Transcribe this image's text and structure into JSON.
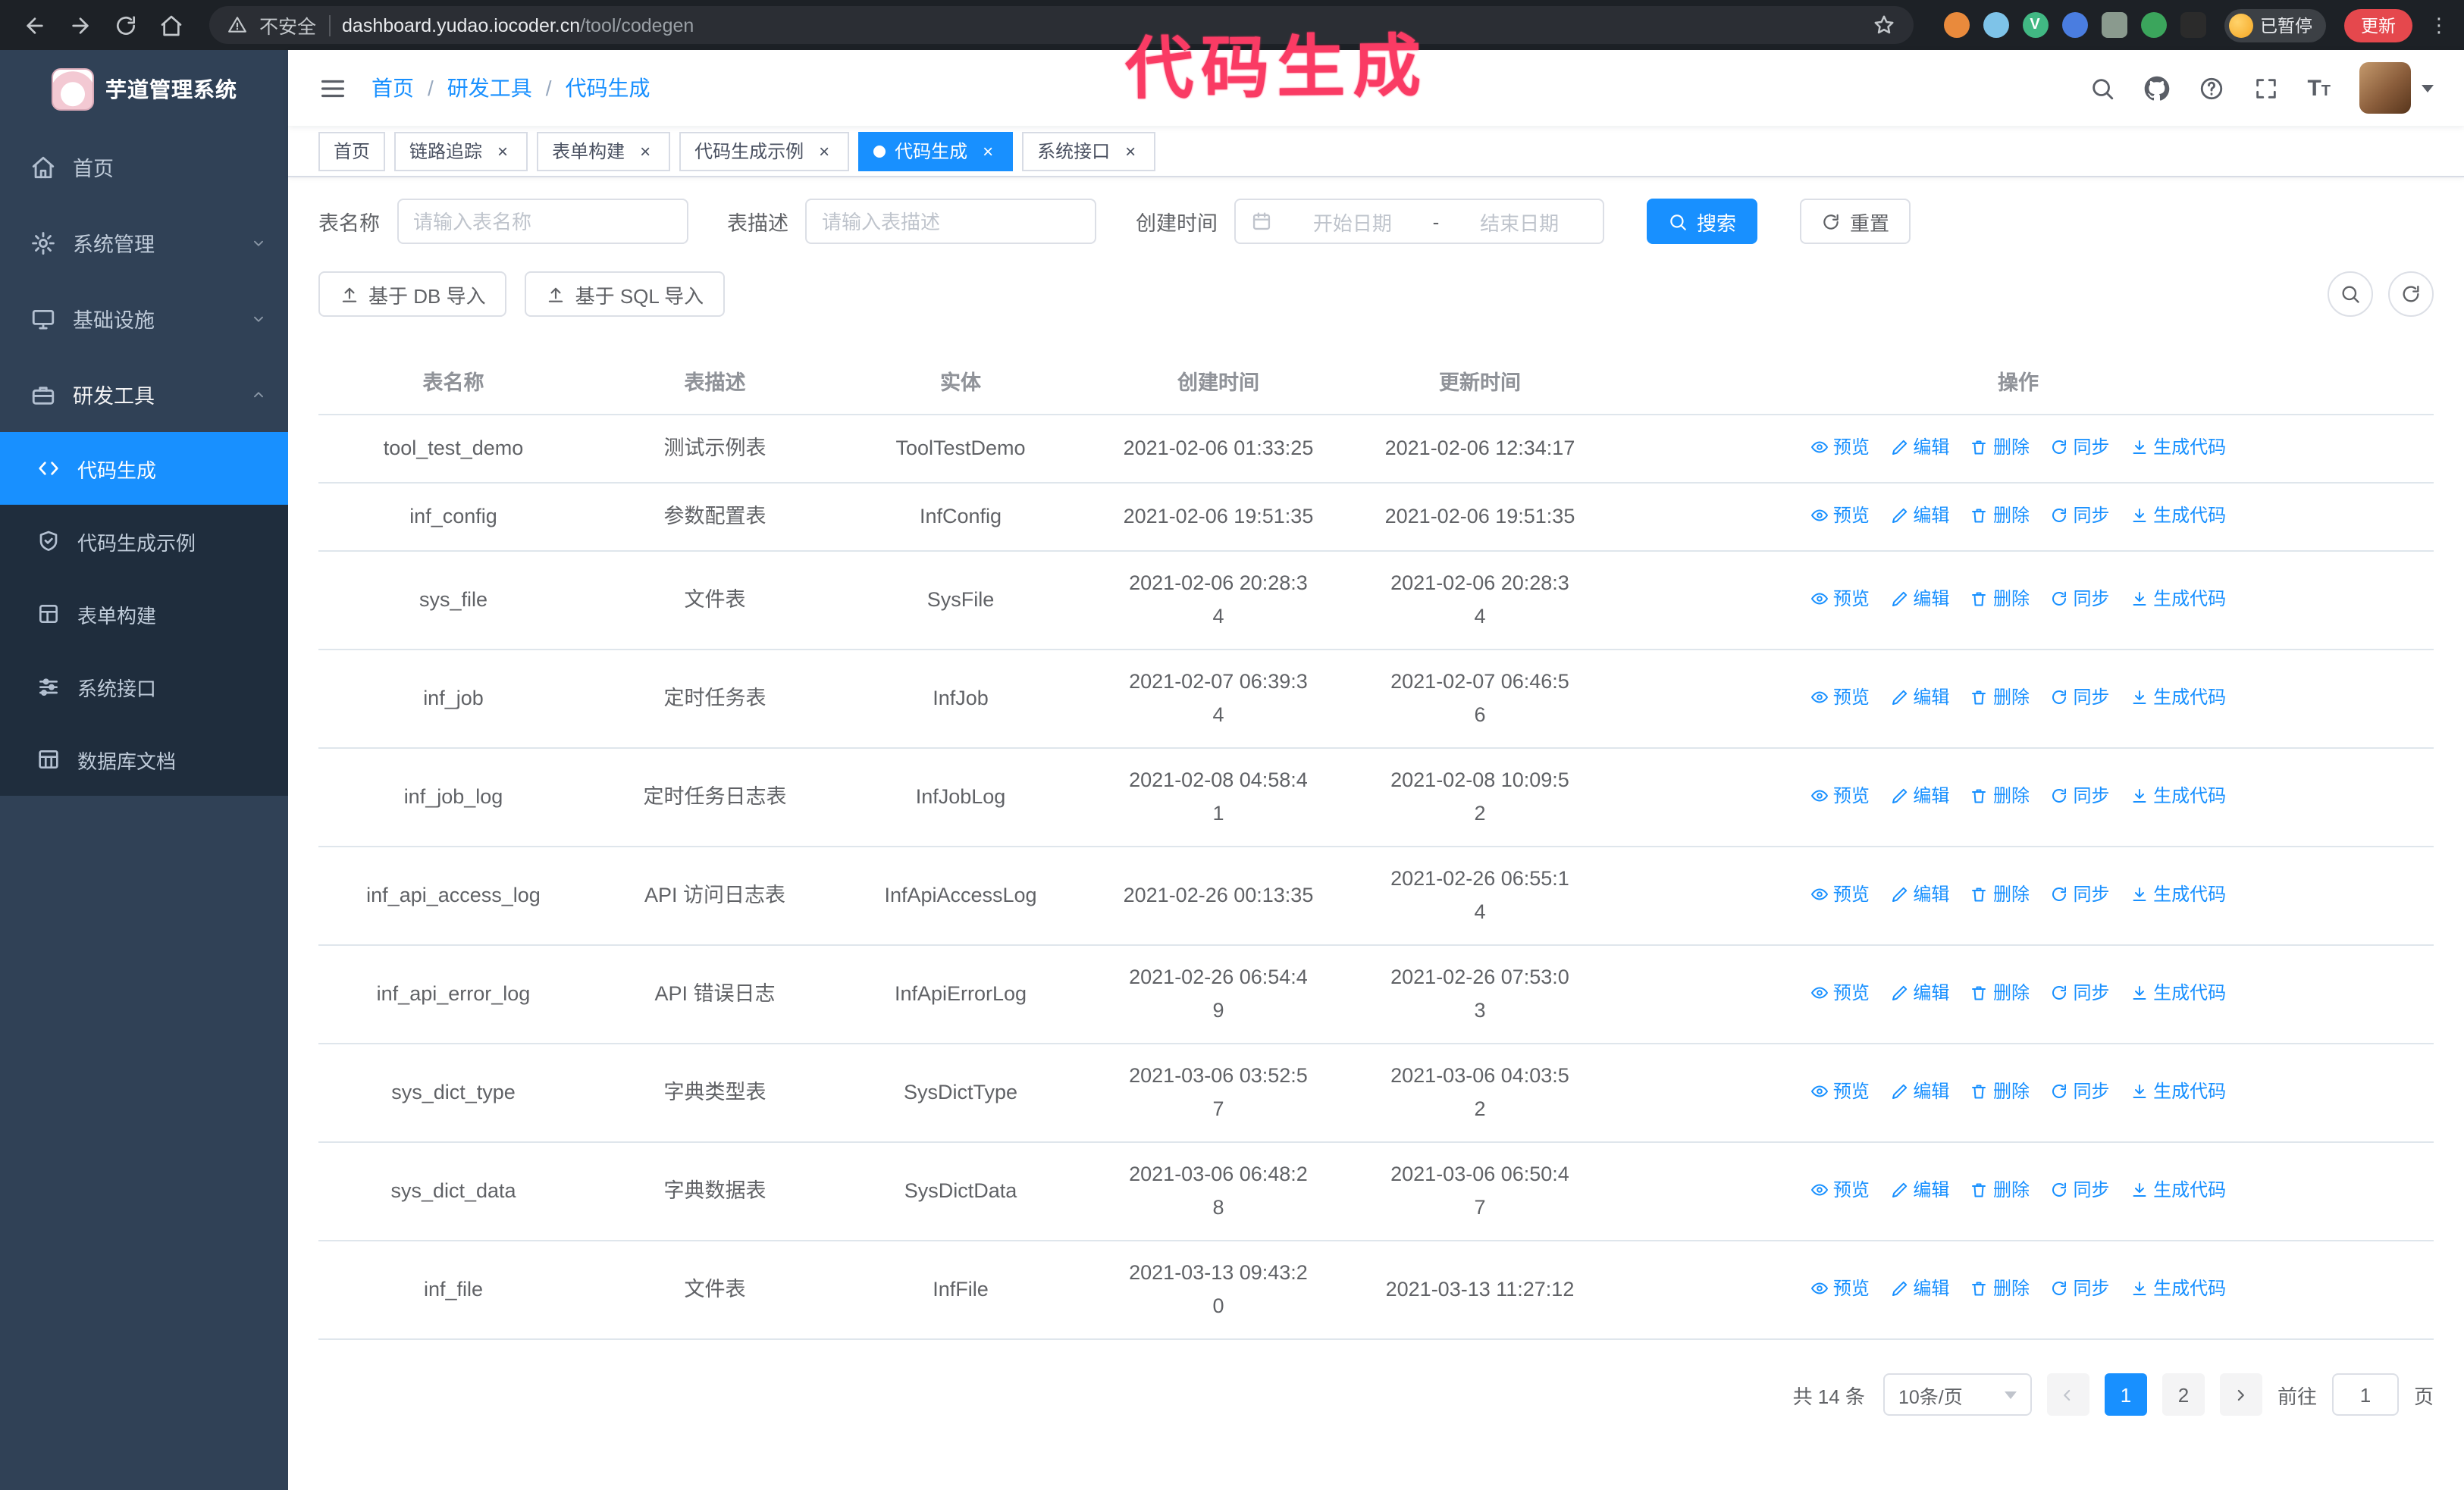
{
  "annotation": {
    "text": "代码生成",
    "color": "#fa3b64"
  },
  "colors": {
    "accent": "#1890ff",
    "sidebar_bg": "#304156",
    "submenu_bg": "#1f2d3d",
    "update_button_bg": "#e5484d",
    "browser_bar_bg": "#1d2126"
  },
  "browser": {
    "security_label": "不安全",
    "url_domain": "dashboard.yudao.iocoder.cn",
    "url_path": "/tool/codegen",
    "profile_badge": "已暂停",
    "update_button": "更新"
  },
  "sidebar": {
    "app_title": "芋道管理系统",
    "menu": [
      {
        "label": "首页"
      },
      {
        "label": "系统管理"
      },
      {
        "label": "基础设施"
      },
      {
        "label": "研发工具"
      }
    ],
    "submenu": [
      {
        "label": "代码生成",
        "active": true
      },
      {
        "label": "代码生成示例"
      },
      {
        "label": "表单构建"
      },
      {
        "label": "系统接口"
      },
      {
        "label": "数据库文档"
      }
    ]
  },
  "navbar": {
    "breadcrumb": [
      "首页",
      "研发工具",
      "代码生成"
    ]
  },
  "tabs": [
    {
      "label": "首页",
      "closable": false,
      "active": false
    },
    {
      "label": "链路追踪",
      "closable": true,
      "active": false
    },
    {
      "label": "表单构建",
      "closable": true,
      "active": false
    },
    {
      "label": "代码生成示例",
      "closable": true,
      "active": false
    },
    {
      "label": "代码生成",
      "closable": true,
      "active": true
    },
    {
      "label": "系统接口",
      "closable": true,
      "active": false
    }
  ],
  "filters": {
    "table_name_label": "表名称",
    "table_name_placeholder": "请输入表名称",
    "table_desc_label": "表描述",
    "table_desc_placeholder": "请输入表描述",
    "create_time_label": "创建时间",
    "date_start_placeholder": "开始日期",
    "date_separator": "-",
    "date_end_placeholder": "结束日期",
    "search_button": "搜索",
    "reset_button": "重置"
  },
  "toolbar": {
    "import_db_button": "基于 DB 导入",
    "import_sql_button": "基于 SQL 导入"
  },
  "table": {
    "columns": [
      "表名称",
      "表描述",
      "实体",
      "创建时间",
      "更新时间",
      "操作"
    ],
    "actions": [
      "预览",
      "编辑",
      "删除",
      "同步",
      "生成代码"
    ],
    "rows": [
      {
        "name": "tool_test_demo",
        "desc": "测试示例表",
        "entity": "ToolTestDemo",
        "created": "2021-02-06 01:33:25",
        "updated": "2021-02-06 12:34:17"
      },
      {
        "name": "inf_config",
        "desc": "参数配置表",
        "entity": "InfConfig",
        "created": "2021-02-06 19:51:35",
        "updated": "2021-02-06 19:51:35"
      },
      {
        "name": "sys_file",
        "desc": "文件表",
        "entity": "SysFile",
        "created": "2021-02-06 20:28:3\n4",
        "updated": "2021-02-06 20:28:3\n4"
      },
      {
        "name": "inf_job",
        "desc": "定时任务表",
        "entity": "InfJob",
        "created": "2021-02-07 06:39:3\n4",
        "updated": "2021-02-07 06:46:5\n6"
      },
      {
        "name": "inf_job_log",
        "desc": "定时任务日志表",
        "entity": "InfJobLog",
        "created": "2021-02-08 04:58:4\n1",
        "updated": "2021-02-08 10:09:5\n2"
      },
      {
        "name": "inf_api_access_log",
        "desc": "API 访问日志表",
        "entity": "InfApiAccessLog",
        "created": "2021-02-26 00:13:35",
        "updated": "2021-02-26 06:55:1\n4"
      },
      {
        "name": "inf_api_error_log",
        "desc": "API 错误日志",
        "entity": "InfApiErrorLog",
        "created": "2021-02-26 06:54:4\n9",
        "updated": "2021-02-26 07:53:0\n3"
      },
      {
        "name": "sys_dict_type",
        "desc": "字典类型表",
        "entity": "SysDictType",
        "created": "2021-03-06 03:52:5\n7",
        "updated": "2021-03-06 04:03:5\n2"
      },
      {
        "name": "sys_dict_data",
        "desc": "字典数据表",
        "entity": "SysDictData",
        "created": "2021-03-06 06:48:2\n8",
        "updated": "2021-03-06 06:50:4\n7"
      },
      {
        "name": "inf_file",
        "desc": "文件表",
        "entity": "InfFile",
        "created": "2021-03-13 09:43:2\n0",
        "updated": "2021-03-13 11:27:12"
      }
    ]
  },
  "pagination": {
    "total": "共 14 条",
    "page_size": "10条/页",
    "pages": [
      "1",
      "2"
    ],
    "active_page": "1",
    "goto_label": "前往",
    "goto_value": "1",
    "goto_suffix": "页"
  }
}
